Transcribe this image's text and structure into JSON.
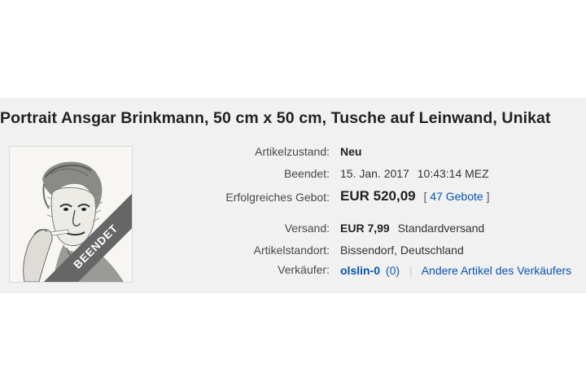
{
  "listing": {
    "title": "Portrait Ansgar Brinkmann, 50 cm x 50 cm, Tusche auf Leinwand, Unikat",
    "ended_badge": "BEENDET",
    "image_alt": "portrait-drawing"
  },
  "details": {
    "condition_label": "Artikelzustand:",
    "condition_value": "Neu",
    "ended_label": "Beendet:",
    "ended_date": "15. Jan. 2017",
    "ended_time": "10:43:14 MEZ",
    "bid_label": "Erfolgreiches Gebot:",
    "bid_value": "EUR 520,09",
    "bid_count_open": "[",
    "bid_count": "47 Gebote",
    "bid_count_close": "]",
    "shipping_label": "Versand:",
    "shipping_price": "EUR 7,99",
    "shipping_method": "Standardversand",
    "location_label": "Artikelstandort:",
    "location_value": "Bissendorf, Deutschland",
    "seller_label": "Verkäufer:",
    "seller_name": "olslin-0",
    "seller_rating_open": "(",
    "seller_rating": "0",
    "seller_rating_close": ")",
    "seller_separator": "|",
    "other_items": "Andere Artikel des Verkäufers"
  },
  "colors": {
    "panel_bg": "#f1f1f1",
    "link": "#0654ba",
    "ribbon": "#666666"
  }
}
